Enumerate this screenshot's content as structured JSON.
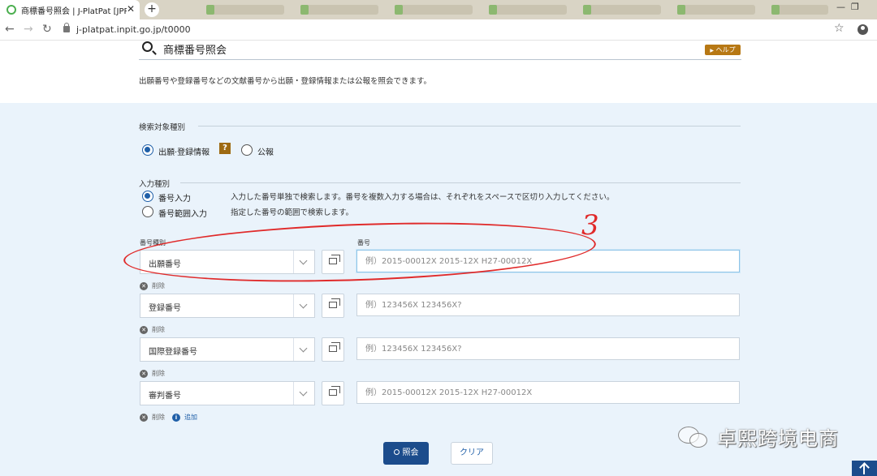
{
  "browser": {
    "tab_title": "商標番号照会 | J-PlatPat [JPP]",
    "tab_close": "✕",
    "new_tab": "+",
    "url": "j-platpat.inpit.go.jp/t0000"
  },
  "page": {
    "title": "商標番号照会",
    "help_label": "ヘルプ",
    "help_arrow": "▶",
    "description": "出願番号や登録番号などの文献番号から出願・登録情報または公報を照会できます。"
  },
  "search_target": {
    "label": "検索対象種別",
    "options": [
      "出願·登録情報",
      "公報"
    ],
    "help_icon": "?"
  },
  "input_type": {
    "label": "入力種別",
    "options": [
      {
        "label": "番号入力",
        "desc": "入力した番号単独で検索します。番号を複数入力する場合は、それぞれをスペースで区切り入力してください。"
      },
      {
        "label": "番号範囲入力",
        "desc": "指定した番号の範囲で検索します。"
      }
    ]
  },
  "fields": {
    "type_label": "番号種別",
    "number_label": "番号",
    "delete_label": "削除",
    "add_label": "追加",
    "rows": [
      {
        "type": "出願番号",
        "placeholder": "例）2015-00012X 2015-12X H27-00012X"
      },
      {
        "type": "登録番号",
        "placeholder": "例）123456X 123456X?"
      },
      {
        "type": "国際登録番号",
        "placeholder": "例）123456X 123456X?"
      },
      {
        "type": "審判番号",
        "placeholder": "例）2015-00012X 2015-12X H27-00012X"
      }
    ]
  },
  "buttons": {
    "search": "照会",
    "clear": "クリア"
  },
  "annotation": {
    "mark": "3",
    "color": "#e02a2a"
  },
  "watermark": {
    "text": "卓熙跨境电商"
  },
  "colors": {
    "primary": "#1c4c8c",
    "panel_bg": "#eaf3fb",
    "help_brown": "#b77814"
  }
}
